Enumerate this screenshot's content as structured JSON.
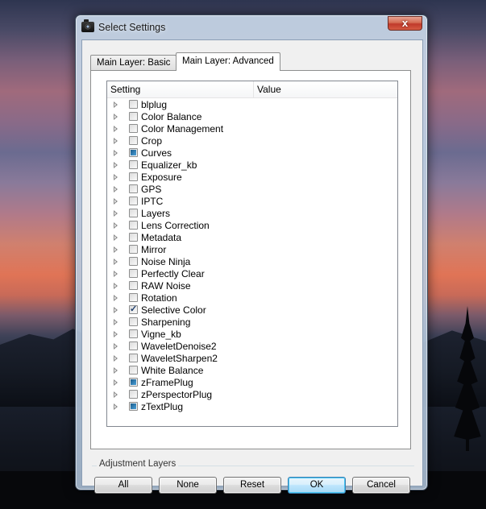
{
  "window": {
    "title": "Select Settings",
    "close_label": "x"
  },
  "tabs": [
    {
      "label": "Main Layer: Basic",
      "active": false
    },
    {
      "label": "Main Layer: Advanced",
      "active": true
    }
  ],
  "list": {
    "columns": [
      "Setting",
      "Value"
    ],
    "items": [
      {
        "label": "blplug",
        "state": "unchecked"
      },
      {
        "label": "Color Balance",
        "state": "unchecked"
      },
      {
        "label": "Color Management",
        "state": "unchecked"
      },
      {
        "label": "Crop",
        "state": "unchecked"
      },
      {
        "label": "Curves",
        "state": "partial"
      },
      {
        "label": "Equalizer_kb",
        "state": "unchecked"
      },
      {
        "label": "Exposure",
        "state": "unchecked"
      },
      {
        "label": "GPS",
        "state": "unchecked"
      },
      {
        "label": "IPTC",
        "state": "unchecked"
      },
      {
        "label": "Layers",
        "state": "unchecked"
      },
      {
        "label": "Lens Correction",
        "state": "unchecked"
      },
      {
        "label": "Metadata",
        "state": "unchecked"
      },
      {
        "label": "Mirror",
        "state": "unchecked"
      },
      {
        "label": "Noise Ninja",
        "state": "unchecked"
      },
      {
        "label": "Perfectly Clear",
        "state": "unchecked"
      },
      {
        "label": "RAW Noise",
        "state": "unchecked"
      },
      {
        "label": "Rotation",
        "state": "unchecked"
      },
      {
        "label": "Selective Color",
        "state": "checked"
      },
      {
        "label": "Sharpening",
        "state": "unchecked"
      },
      {
        "label": "Vigne_kb",
        "state": "unchecked"
      },
      {
        "label": "WaveletDenoise2",
        "state": "unchecked"
      },
      {
        "label": "WaveletSharpen2",
        "state": "unchecked"
      },
      {
        "label": "White Balance",
        "state": "unchecked"
      },
      {
        "label": "zFramePlug",
        "state": "partial"
      },
      {
        "label": "zPerspectorPlug",
        "state": "unchecked"
      },
      {
        "label": "zTextPlug",
        "state": "partial"
      }
    ]
  },
  "groupbox": {
    "label": "Adjustment Layers"
  },
  "buttons": {
    "all": "All",
    "none": "None",
    "reset": "Reset",
    "ok": "OK",
    "cancel": "Cancel"
  },
  "colors": {
    "check_partial": "#2a7ab8",
    "default_button_border": "#3c7fb1"
  }
}
